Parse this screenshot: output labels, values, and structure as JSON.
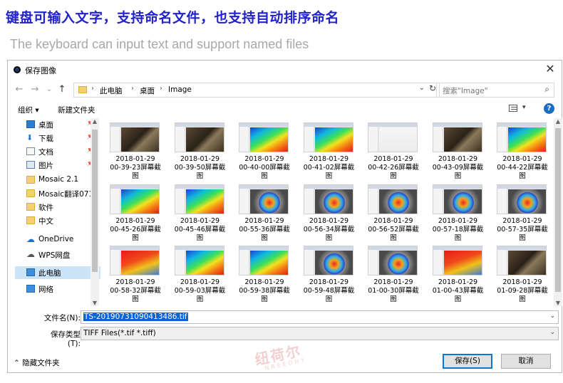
{
  "banner": {
    "chinese": "键盘可输入文字，支持命名文件，也支持自动排序命名",
    "english": "The keyboard can input text and support named files"
  },
  "dialog": {
    "title": "保存图像",
    "close": "✕",
    "nav": {
      "back": "←",
      "forward": "→",
      "recent": "⌄",
      "up": "↑"
    },
    "breadcrumb": [
      "此电脑",
      "桌面",
      "Image"
    ],
    "search_placeholder": "搜索\"Image\"",
    "toolbar": {
      "organize": "组织 ▾",
      "new_folder": "新建文件夹",
      "help": "?"
    },
    "sidebar": [
      {
        "label": "桌面",
        "icon": "desktop-icon",
        "pinned": true
      },
      {
        "label": "下载",
        "icon": "download-icon",
        "pinned": true
      },
      {
        "label": "文档",
        "icon": "document-icon",
        "pinned": true
      },
      {
        "label": "图片",
        "icon": "picture-icon",
        "pinned": true
      },
      {
        "label": "Mosaic 2.1",
        "icon": "folder-icon",
        "pinned": false
      },
      {
        "label": "Mosaic翻译071",
        "icon": "folder-icon",
        "pinned": false
      },
      {
        "label": "软件",
        "icon": "folder-icon",
        "pinned": false
      },
      {
        "label": "中文",
        "icon": "folder-icon",
        "pinned": false
      },
      {
        "label": "OneDrive",
        "icon": "cloud-icon",
        "pinned": false
      },
      {
        "label": "WPS网盘",
        "icon": "cloud-icon",
        "pinned": false
      },
      {
        "label": "此电脑",
        "icon": "computer-icon",
        "pinned": false,
        "selected": true
      },
      {
        "label": "网络",
        "icon": "network-icon",
        "pinned": false
      }
    ],
    "files": [
      {
        "line1": "2018-01-29",
        "line2": "00-39-23屏幕截",
        "line3": "图",
        "style": "dark"
      },
      {
        "line1": "2018-01-29",
        "line2": "00-39-50屏幕截",
        "line3": "图",
        "style": "dark"
      },
      {
        "line1": "2018-01-29",
        "line2": "00-40-00屏幕截",
        "line3": "图",
        "style": "heat"
      },
      {
        "line1": "2018-01-29",
        "line2": "00-41-02屏幕截",
        "line3": "图",
        "style": "heat"
      },
      {
        "line1": "2018-01-29",
        "line2": "00-42-26屏幕截",
        "line3": "图",
        "style": "blank"
      },
      {
        "line1": "2018-01-29",
        "line2": "00-43-09屏幕截",
        "line3": "图",
        "style": "dark"
      },
      {
        "line1": "2018-01-29",
        "line2": "00-44-22屏幕截",
        "line3": "图",
        "style": "heat"
      },
      {
        "line1": "2018-01-29",
        "line2": "00-45-26屏幕截",
        "line3": "图",
        "style": "heat"
      },
      {
        "line1": "2018-01-29",
        "line2": "00-45-46屏幕截",
        "line3": "图",
        "style": "heat"
      },
      {
        "line1": "2018-01-29",
        "line2": "00-55-36屏幕截",
        "line3": "图",
        "style": "box"
      },
      {
        "line1": "2018-01-29",
        "line2": "00-56-34屏幕截",
        "line3": "图",
        "style": "box"
      },
      {
        "line1": "2018-01-29",
        "line2": "00-56-52屏幕截",
        "line3": "图",
        "style": "box"
      },
      {
        "line1": "2018-01-29",
        "line2": "00-57-18屏幕截",
        "line3": "图",
        "style": "box"
      },
      {
        "line1": "2018-01-29",
        "line2": "00-57-35屏幕截",
        "line3": "图",
        "style": "box"
      },
      {
        "line1": "2018-01-29",
        "line2": "00-58-32屏幕截",
        "line3": "图",
        "style": "red"
      },
      {
        "line1": "2018-01-29",
        "line2": "00-59-03屏幕截",
        "line3": "图",
        "style": "heat"
      },
      {
        "line1": "2018-01-29",
        "line2": "00-59-38屏幕截",
        "line3": "图",
        "style": "heat"
      },
      {
        "line1": "2018-01-29",
        "line2": "00-59-48屏幕截",
        "line3": "图",
        "style": "box"
      },
      {
        "line1": "2018-01-29",
        "line2": "01-00-30屏幕截",
        "line3": "图",
        "style": "box"
      },
      {
        "line1": "2018-01-29",
        "line2": "01-00-43屏幕截",
        "line3": "图",
        "style": "red"
      },
      {
        "line1": "2018-01-29",
        "line2": "01-09-28屏幕截",
        "line3": "图",
        "style": "dark"
      }
    ],
    "filename_label": "文件名(N):",
    "filename_value": "TS-20190731090413486.tif",
    "filetype_label": "保存类型(T):",
    "filetype_value": "TIFF Files(*.tif *.tiff)",
    "hide_folders": "⌃ 隐藏文件夹",
    "save_button": "保存(S)",
    "cancel_button": "取消",
    "watermark": "纽荷尔",
    "watermark_sub": "NREEOHY",
    "colors": {
      "accent": "#0078d7",
      "selection": "#0a64d8",
      "banner": "#2222cc"
    }
  }
}
